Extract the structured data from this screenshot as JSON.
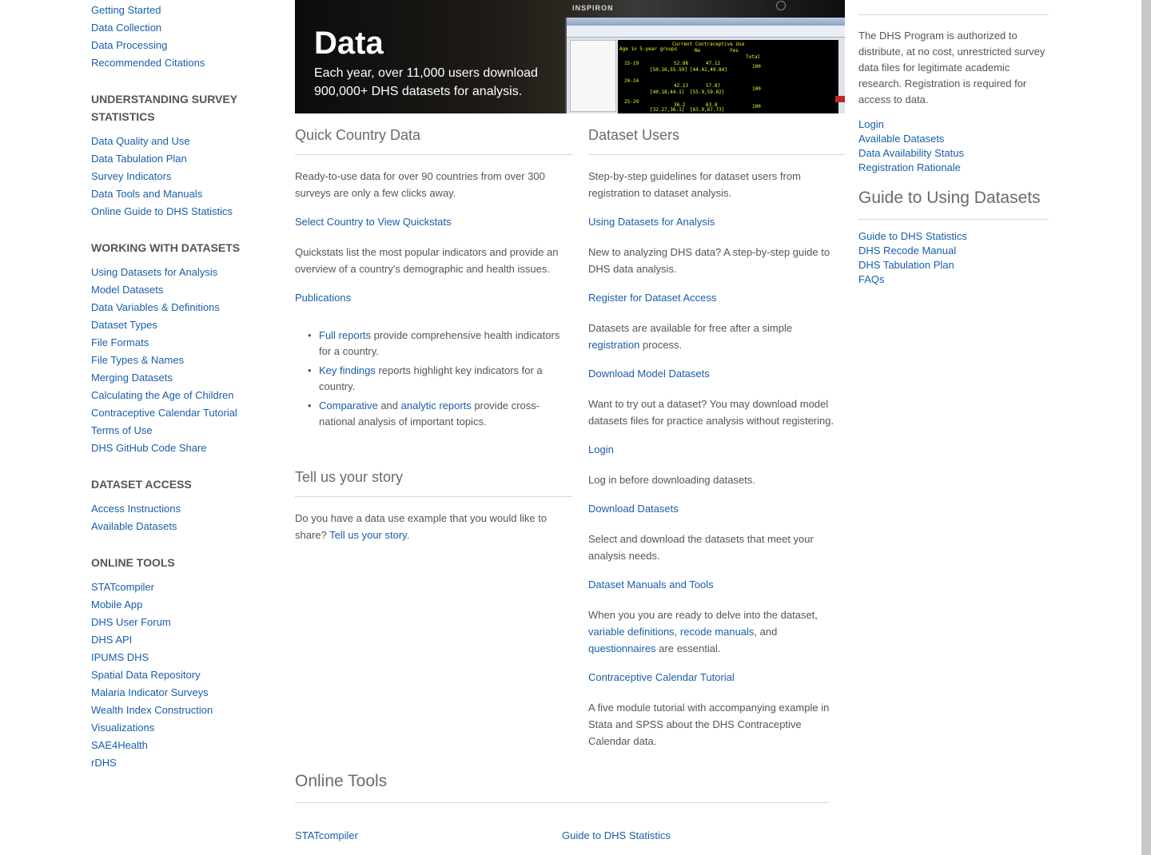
{
  "left_nav": {
    "top_links": [
      "Getting Started",
      "Data Collection",
      "Data Processing",
      "Recommended Citations"
    ],
    "sections": [
      {
        "heading": "UNDERSTANDING SURVEY STATISTICS",
        "links": [
          "Data Quality and Use",
          "Data Tabulation Plan",
          "Survey Indicators",
          "Data Tools and Manuals",
          "Online Guide to DHS Statistics"
        ]
      },
      {
        "heading": "WORKING WITH DATASETS",
        "links": [
          "Using Datasets for Analysis",
          "Model Datasets",
          "Data Variables & Definitions",
          "Dataset Types",
          "File Formats",
          "File Types & Names",
          "Merging Datasets",
          "Calculating the Age of Children",
          "Contraceptive Calendar Tutorial",
          "Terms of Use",
          "DHS GitHub Code Share"
        ]
      },
      {
        "heading": "DATASET ACCESS",
        "links": [
          "Access Instructions",
          "Available Datasets"
        ]
      },
      {
        "heading": "ONLINE TOOLS",
        "links": [
          "STATcompiler",
          "Mobile App",
          "DHS User Forum",
          "DHS API",
          "IPUMS DHS",
          "Spatial Data Repository",
          "Malaria Indicator Surveys",
          "Wealth Index Construction",
          "Visualizations",
          "SAE4Health",
          "rDHS"
        ]
      }
    ]
  },
  "hero": {
    "title": "Data",
    "text": "Each year, over 11,000 users download 900,000+ DHS datasets for analysis.",
    "laptop_label": "INSPIRON",
    "screen_rows": [
      "Current Contraceptive Use",
      "No",
      "Yes",
      "Total",
      "15-19",
      "52.88",
      "47.12",
      "100",
      "[50.16,55.59]",
      "[44.41,49.84]",
      "20-24",
      "42.13",
      "57.87",
      "100",
      "[40.18,44.1]",
      "[55.9,59.82]",
      "25-29",
      "36.2",
      "63.8",
      "100",
      "[32.27,36.1]",
      "[63.9,67.73]",
      "Age in 5-year groups"
    ]
  },
  "quick_country": {
    "heading": "Quick Country Data",
    "intro": "Ready-to-use data for over 90 countries from over 300 surveys are only a few clicks away.",
    "quickstats_link": "Select Country to View Quickstats",
    "quickstats_text": "Quickstats list the most popular indicators and provide an overview of a country's demographic and health issues.",
    "publications_link": "Publications",
    "bullets": [
      {
        "link": "Full reports",
        "text": " provide comprehensive health indicators for a country."
      },
      {
        "link": "Key findings",
        "text": " reports highlight key indicators for a country."
      },
      {
        "link": "Comparative",
        "mid": " and ",
        "link2": "analytic reports",
        "text": " provide cross-national analysis of important topics."
      }
    ]
  },
  "story": {
    "heading": "Tell us your story",
    "text": "Do you have a data use example that you would like to share? ",
    "link": "Tell us your story."
  },
  "dataset_users": {
    "heading": "Dataset Users",
    "intro": "Step-by-step guidelines for dataset users from registration to dataset analysis.",
    "items": [
      {
        "link": "Using Datasets for Analysis",
        "text": "New to analyzing DHS data? A step-by-step guide to DHS data analysis."
      },
      {
        "link": "Register for Dataset Access",
        "text_before": "Datasets are available for free after a simple ",
        "inline_link": "registration",
        "text_after": " process."
      },
      {
        "link": "Download Model Datasets",
        "text": "Want to try out a dataset? You may download model datasets files for practice analysis without registering."
      },
      {
        "link": "Login",
        "text": "Log in before downloading datasets."
      },
      {
        "link": "Download Datasets",
        "text": "Select and download the datasets that meet your analysis needs."
      },
      {
        "link": "Dataset Manuals and Tools",
        "text_before": "When you you are ready to delve into the dataset, ",
        "inline_link": "variable definitions",
        "sep1": ", ",
        "inline_link2": "recode manuals",
        "sep2": ", and ",
        "inline_link3": "questionnaires",
        "text_after": " are essential."
      },
      {
        "link": "Contraceptive Calendar Tutorial",
        "text": "A five module tutorial with accompanying example in Stata and SPSS about the DHS Contraceptive Calendar data."
      }
    ]
  },
  "right_col": {
    "auth_text": "The DHS Program is authorized to distribute, at no cost, unrestricted survey data files for legitimate academic research. Registration is required for access to data.",
    "access_links": [
      "Login",
      "Available Datasets",
      "Data Availability Status",
      "Registration Rationale"
    ],
    "guide_heading": "Guide to Using Datasets",
    "guide_links": [
      "Guide to DHS Statistics",
      "DHS Recode Manual",
      "DHS Tabulation Plan",
      "FAQs"
    ]
  },
  "online_tools": {
    "heading": "Online Tools",
    "links": [
      "STATcompiler",
      "Guide to DHS Statistics"
    ]
  }
}
